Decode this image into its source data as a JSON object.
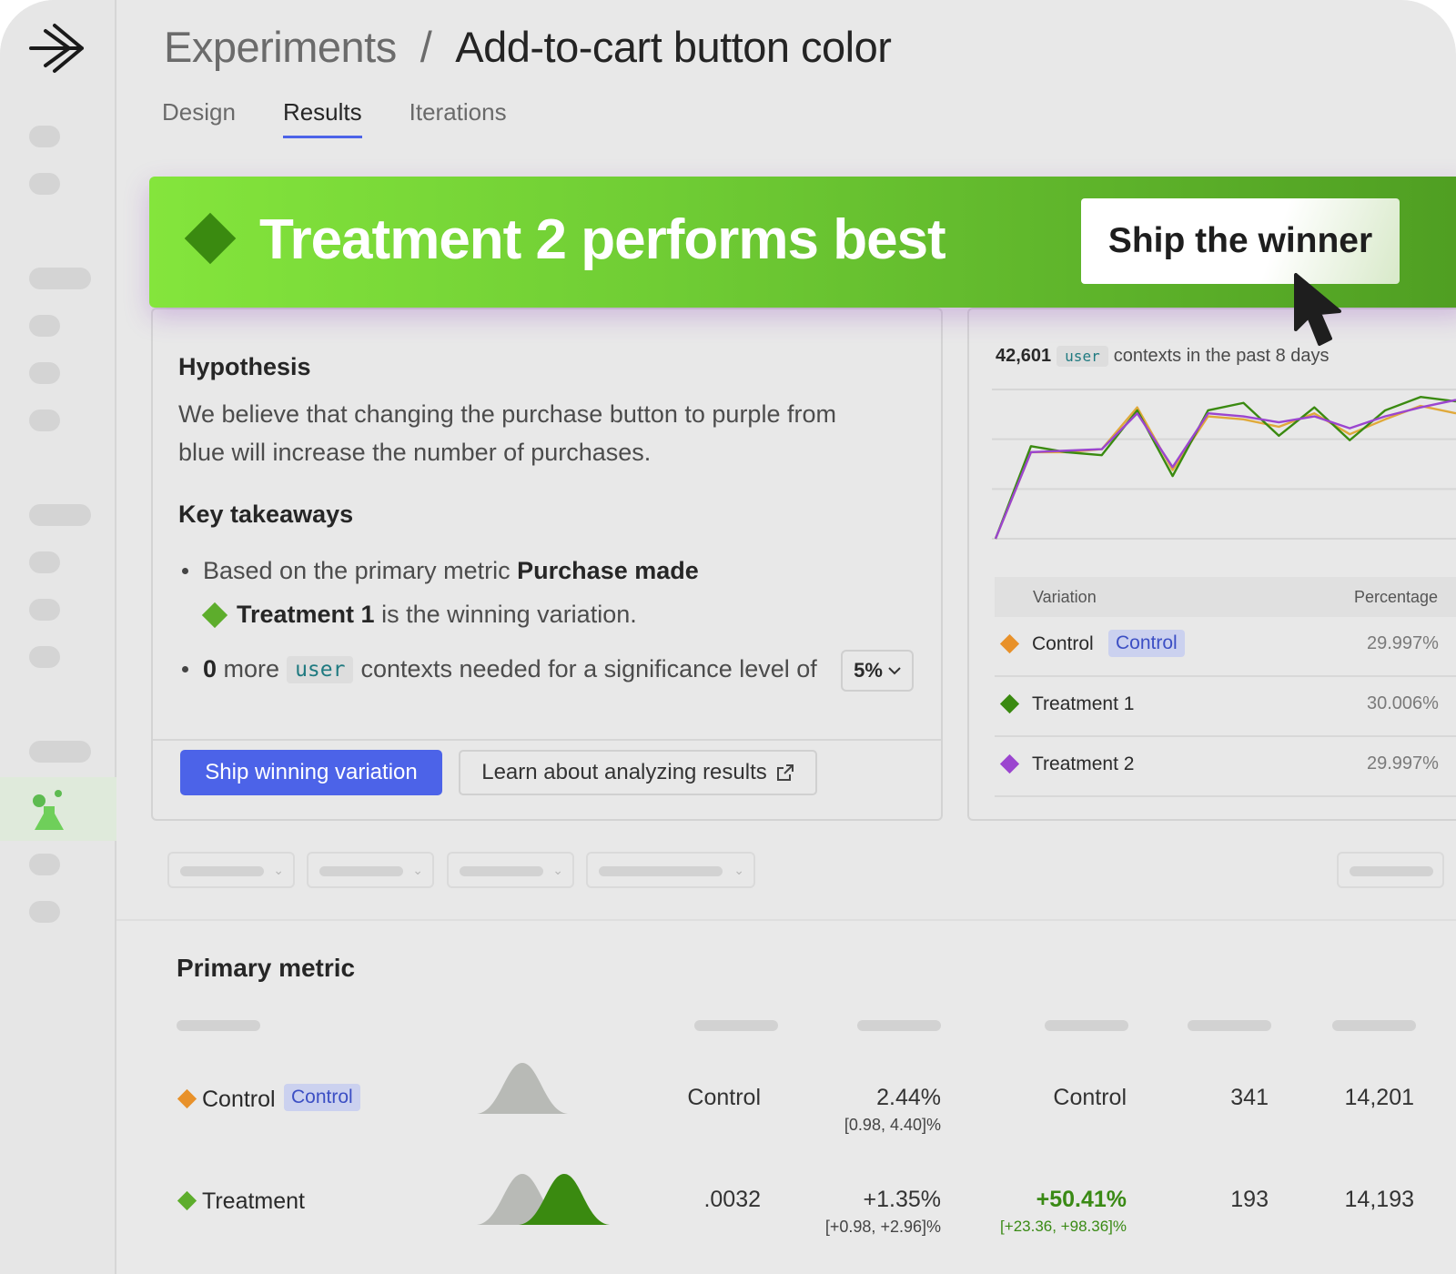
{
  "breadcrumb": {
    "parent": "Experiments",
    "separator": "/",
    "current": "Add-to-cart button color"
  },
  "tabs": [
    {
      "label": "Design"
    },
    {
      "label": "Results",
      "active": true
    },
    {
      "label": "Iterations"
    }
  ],
  "banner": {
    "title": "Treatment 2  performs best",
    "button": "Ship the winner"
  },
  "hypothesis": {
    "label": "Hypothesis",
    "text": "We believe that changing the purchase button to purple from blue will increase the number of purchases."
  },
  "takeaways": {
    "label": "Key takeaways",
    "b1_prefix": "Based on the primary metric ",
    "b1_metric": "Purchase made",
    "b1_variation": "Treatment 1",
    "b1_suffix": "is the winning variation.",
    "b2_count": "0",
    "b2_more": "more",
    "b2_code": "user",
    "b2_suffix": "contexts needed for a significance level of",
    "significance": "5%"
  },
  "actions": {
    "primary": "Ship winning variation",
    "secondary": "Learn about analyzing results"
  },
  "traffic": {
    "count": "42,601",
    "code": "user",
    "suffix": "contexts in the past 8 days",
    "headers": {
      "variation": "Variation",
      "percentage": "Percentage"
    },
    "rows": [
      {
        "name": "Control",
        "badge": "Control",
        "pct": "29.997%",
        "color": "#e8912a"
      },
      {
        "name": "Treatment 1",
        "pct": "30.006%",
        "color": "#3a8a10"
      },
      {
        "name": "Treatment 2",
        "pct": "29.997%",
        "color": "#9b45cf"
      }
    ]
  },
  "primary_metric": {
    "title": "Primary metric",
    "rows": [
      {
        "name": "Control",
        "badge": "Control",
        "c1": "Control",
        "c2": "2.44%",
        "c2_sub": "[0.98, 4.40]%",
        "c3": "Control",
        "c4": "341",
        "c5": "14,201"
      },
      {
        "name": "Treatment",
        "c1": ".0032",
        "c2": "+1.35%",
        "c2_sub": "[+0.98, +2.96]%",
        "c3": "+50.41%",
        "c3_sub": "[+23.36, +98.36]%",
        "c4": "193",
        "c5": "14,193"
      }
    ]
  },
  "colors": {
    "accent": "#4c63e8",
    "winner_green": "#6fcc34",
    "control": "#e8912a",
    "treatment1": "#3a8a10",
    "treatment2": "#9b45cf"
  },
  "chart_data": {
    "type": "line",
    "series": [
      {
        "color": "#e0a93a",
        "values": [
          0,
          58,
          58,
          60,
          88,
          46,
          82,
          80,
          75,
          84,
          70,
          80,
          89,
          84
        ]
      },
      {
        "color": "#3a8a10",
        "values": [
          0,
          62,
          58,
          56,
          86,
          42,
          86,
          91,
          69,
          88,
          66,
          86,
          95,
          92
        ]
      },
      {
        "color": "#9b45cf",
        "values": [
          0,
          58,
          59,
          60,
          84,
          48,
          84,
          82,
          78,
          82,
          74,
          82,
          88,
          93
        ]
      }
    ],
    "ylim": [
      0,
      100
    ],
    "grid": true
  }
}
